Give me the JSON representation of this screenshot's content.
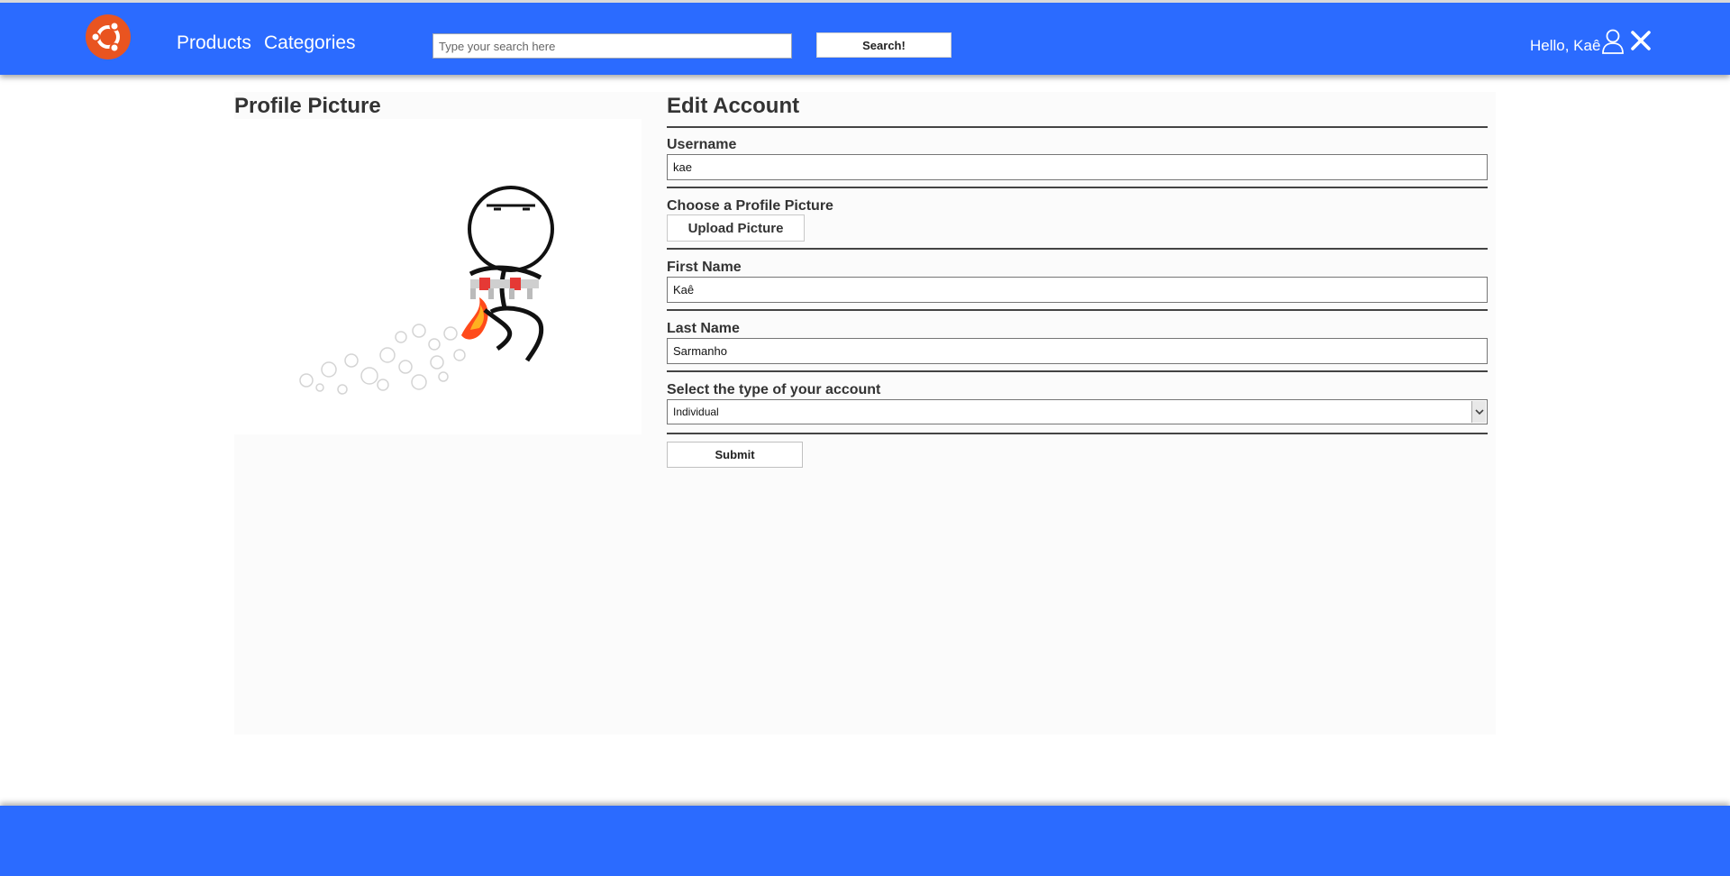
{
  "header": {
    "logo_icon": "ubuntu-logo-icon",
    "nav": [
      {
        "label": "Products"
      },
      {
        "label": "Categories"
      }
    ],
    "search": {
      "placeholder": "Type your search here",
      "value": "",
      "button_label": "Search!"
    },
    "greeting": "Hello, Kaê",
    "user_icon": "user-icon",
    "close_icon": "close-icon",
    "brand_color": "#2b6bff"
  },
  "profile": {
    "title": "Profile Picture",
    "picture_icon": "jetpack-stick-figure-image"
  },
  "form": {
    "title": "Edit Account",
    "username": {
      "label": "Username",
      "value": "kae"
    },
    "picture": {
      "label": "Choose a Profile Picture",
      "button_label": "Upload Picture"
    },
    "first_name": {
      "label": "First Name",
      "value": "Kaê"
    },
    "last_name": {
      "label": "Last Name",
      "value": "Sarmanho"
    },
    "account_type": {
      "label": "Select the type of your account",
      "selected": "Individual"
    },
    "submit_label": "Submit"
  }
}
